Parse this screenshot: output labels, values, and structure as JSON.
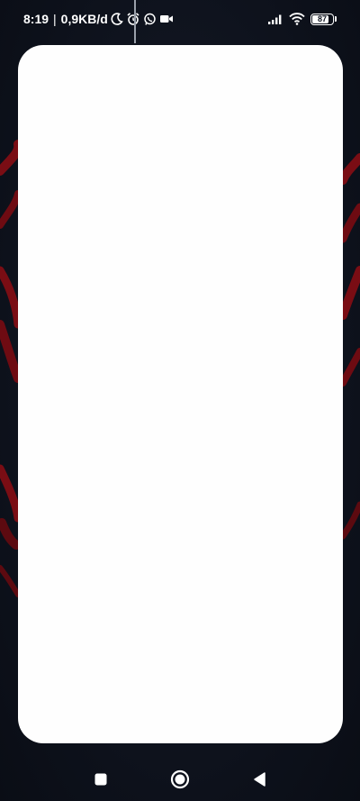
{
  "status_bar": {
    "time": "8:19",
    "separator": "|",
    "network_speed": "0,9KB/d",
    "battery_level": "87",
    "battery_fraction": 0.87,
    "left_icons": [
      "moon-icon",
      "alarm-icon",
      "whatsapp-icon",
      "video-camera-icon"
    ],
    "right_icons": [
      "signal-icon",
      "wifi-icon",
      "battery-icon"
    ]
  },
  "wallpaper": {
    "accent_color": "#7a0d14",
    "background_color": "#0f1420"
  },
  "app_card": {
    "background_color": "#fefefe"
  },
  "nav_bar": {
    "buttons": [
      "recents-button",
      "home-button",
      "back-button"
    ]
  }
}
